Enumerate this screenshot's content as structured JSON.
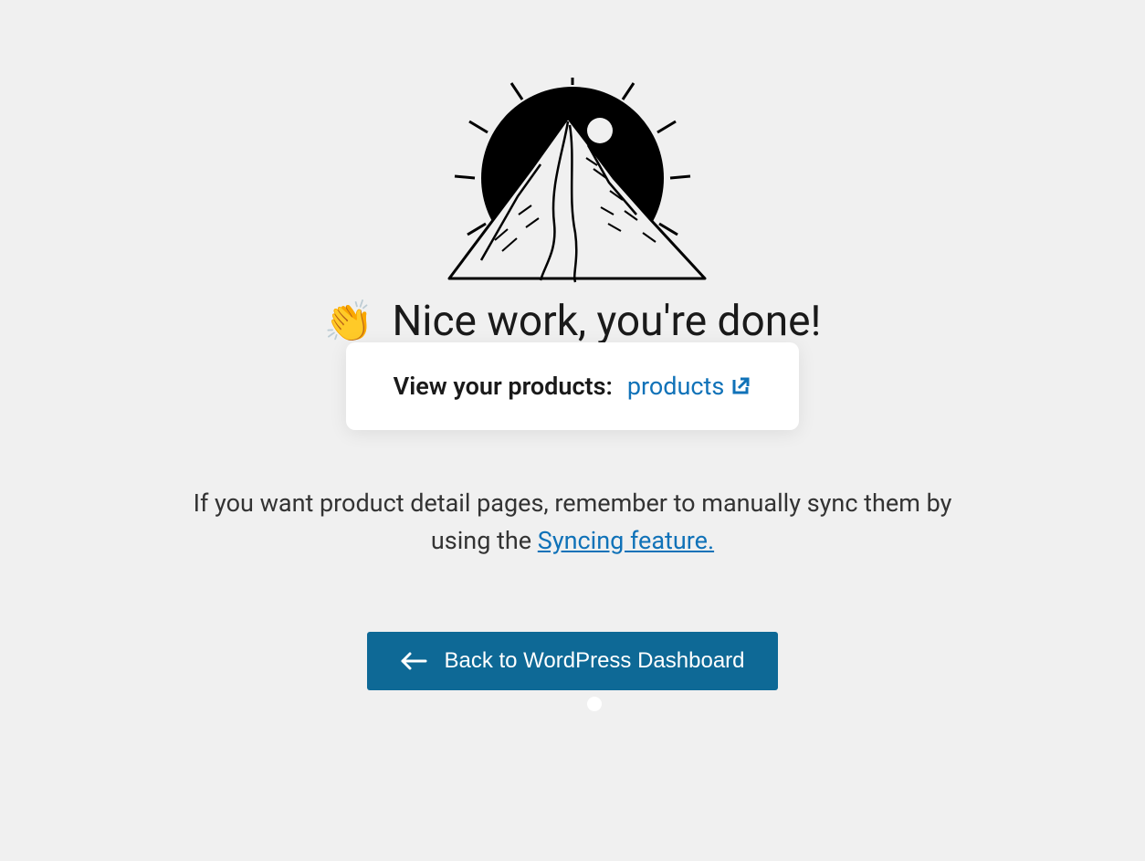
{
  "heading": {
    "emoji": "👏",
    "text": "Nice work, you're done!"
  },
  "card": {
    "label": "View your products:",
    "link_text": "products"
  },
  "help": {
    "prefix": "If you want product detail pages, remember to manually sync them by using the ",
    "link_text": "Syncing feature."
  },
  "button": {
    "label": "Back to WordPress Dashboard"
  }
}
